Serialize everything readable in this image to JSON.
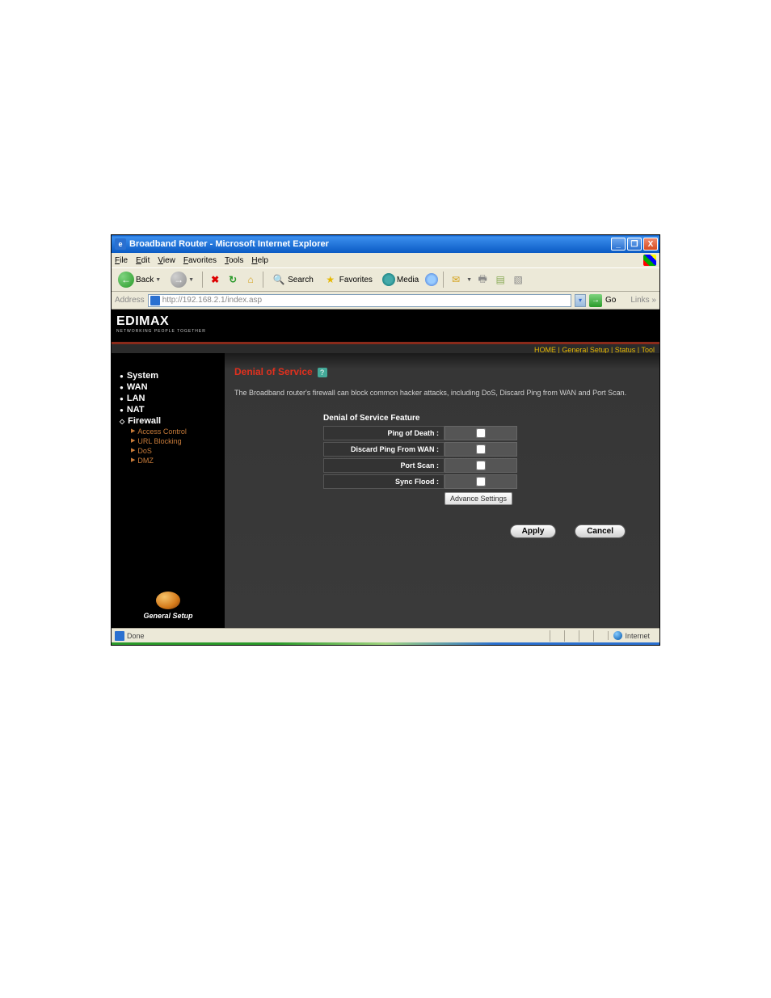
{
  "window": {
    "title": "Broadband Router - Microsoft Internet Explorer"
  },
  "menu": {
    "file": "File",
    "edit": "Edit",
    "view": "View",
    "favorites": "Favorites",
    "tools": "Tools",
    "help": "Help"
  },
  "toolbar": {
    "back": "Back",
    "search": "Search",
    "favorites": "Favorites",
    "media": "Media"
  },
  "address": {
    "label": "Address",
    "url": "http://192.168.2.1/index.asp",
    "go": "Go",
    "links": "Links »"
  },
  "brand": {
    "name": "EDIMAX",
    "tag": "NETWORKING PEOPLE TOGETHER"
  },
  "topnav": {
    "home": "HOME",
    "general": "General Setup",
    "status": "Status",
    "tool": "Tool"
  },
  "sidebar": {
    "system": "System",
    "wan": "WAN",
    "lan": "LAN",
    "nat": "NAT",
    "firewall": "Firewall",
    "access": "Access Control",
    "url": "URL Blocking",
    "dos": "DoS",
    "dmz": "DMZ",
    "gensetup": "General Setup"
  },
  "page": {
    "title": "Denial of Service",
    "desc": "The Broadband router's firewall can block common hacker attacks, including DoS, Discard Ping from WAN and Port Scan.",
    "feature_title": "Denial of Service Feature",
    "rows": {
      "ping": "Ping of Death :",
      "discard": "Discard Ping From WAN :",
      "portscan": "Port Scan :",
      "sync": "Sync Flood :"
    },
    "advance": "Advance Settings",
    "apply": "Apply",
    "cancel": "Cancel"
  },
  "status": {
    "done": "Done",
    "internet": "Internet"
  }
}
